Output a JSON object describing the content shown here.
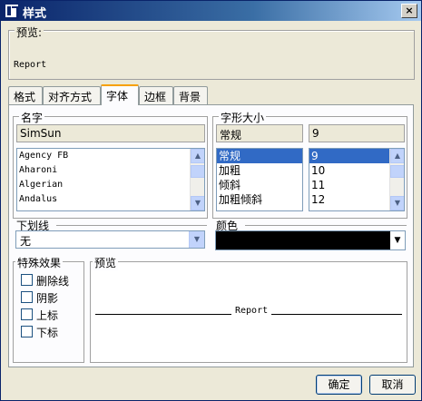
{
  "window": {
    "title": "样式",
    "close_label": "×"
  },
  "preview_top": {
    "legend": "预览:",
    "sample": "Report"
  },
  "tabs": [
    {
      "label": "格式"
    },
    {
      "label": "对齐方式"
    },
    {
      "label": "字体"
    },
    {
      "label": "边框"
    },
    {
      "label": "背景"
    }
  ],
  "name_group": {
    "legend": "名字",
    "current": "SimSun",
    "fonts": [
      "Agency FB",
      "Aharoni",
      "Algerian",
      "Andalus"
    ]
  },
  "style_size_group": {
    "legend": "字形大小",
    "current_style": "常规",
    "current_size": "9",
    "styles": [
      "常规",
      "加粗",
      "倾斜",
      "加粗倾斜"
    ],
    "sizes": [
      "9",
      "10",
      "11",
      "12"
    ]
  },
  "underline": {
    "legend": "下划线",
    "value": "无"
  },
  "color": {
    "legend": "颜色",
    "value_hex": "#000000"
  },
  "effects": {
    "legend": "特殊效果",
    "items": [
      "删除线",
      "阴影",
      "上标",
      "下标"
    ]
  },
  "preview_bottom": {
    "legend": "预览",
    "sample": "Report"
  },
  "buttons": {
    "ok": "确定",
    "cancel": "取消"
  }
}
